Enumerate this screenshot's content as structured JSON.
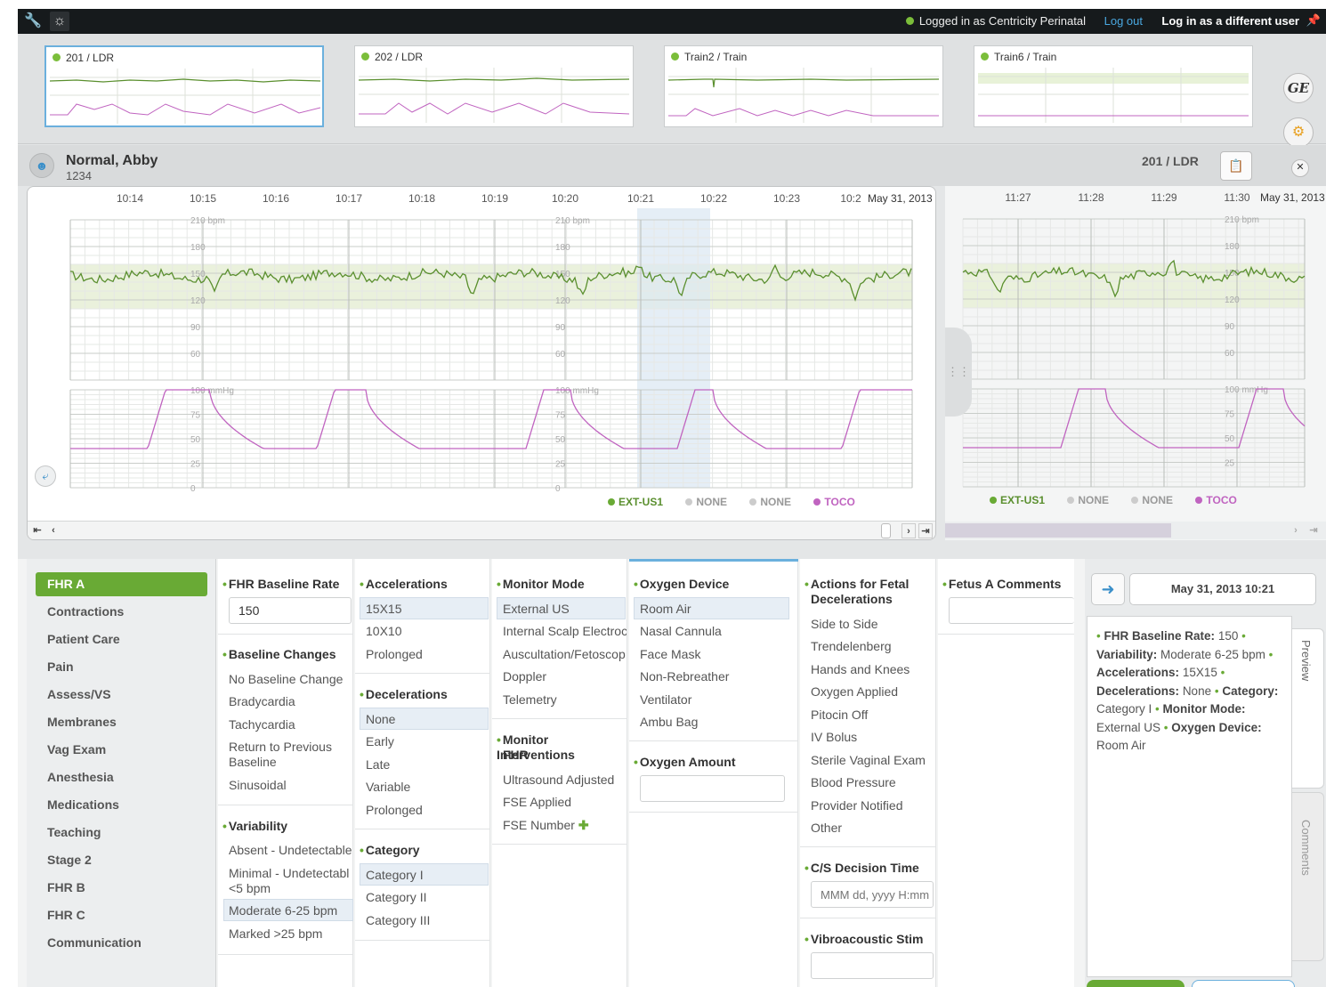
{
  "topbar": {
    "wrench_icon": "wrench-icon",
    "status": "Logged in as Centricity Perinatal",
    "logout": "Log out",
    "different_user": "Log in as a different user"
  },
  "monitors": [
    {
      "label": "201 / LDR"
    },
    {
      "label": "202 / LDR"
    },
    {
      "label": "Train2 / Train"
    },
    {
      "label": "Train6 / Train"
    }
  ],
  "patient": {
    "name": "Normal, Abby",
    "id": "1234",
    "bed": "201 / LDR"
  },
  "chart": {
    "times": [
      "10:14",
      "10:15",
      "10:16",
      "10:17",
      "10:18",
      "10:19",
      "10:20",
      "10:21",
      "10:22",
      "10:23",
      "10:2"
    ],
    "date": "May 31, 2013",
    "fhr_labels": [
      "210 bpm",
      "180",
      "150",
      "120",
      "90",
      "60"
    ],
    "uc_labels": [
      "100 mmHg",
      "75",
      "50",
      "25",
      "0"
    ],
    "legend": [
      "EXT-US1",
      "NONE",
      "NONE",
      "TOCO"
    ]
  },
  "chart_right": {
    "times": [
      "11:27",
      "11:28",
      "11:29",
      "11:30"
    ],
    "date": "May 31, 2013",
    "fhr_labels": [
      "210 bpm",
      "180",
      "150",
      "120",
      "90",
      "60"
    ],
    "uc_labels": [
      "100 mmHg",
      "75",
      "50",
      "25"
    ],
    "legend": [
      "EXT-US1",
      "NONE",
      "NONE",
      "TOCO"
    ]
  },
  "colors": {
    "accent": "#69aa35",
    "fhr": "#5a8f2e",
    "toco": "#c064c0",
    "select_blue": "#6bb0dd"
  },
  "nav": [
    "FHR A",
    "Contractions",
    "Patient Care",
    "Pain",
    "Assess/VS",
    "Membranes",
    "Vag Exam",
    "Anesthesia",
    "Medications",
    "Teaching",
    "Stage 2",
    "FHR B",
    "FHR C",
    "Communication"
  ],
  "form": {
    "fhr_baseline_rate": {
      "title": "FHR Baseline Rate",
      "value": "150"
    },
    "baseline_changes": {
      "title": "Baseline Changes",
      "options": [
        "No Baseline Change",
        "Bradycardia",
        "Tachycardia",
        "Return to Previous",
        "Baseline",
        "Sinusoidal"
      ]
    },
    "variability": {
      "title": "Variability",
      "options": [
        "Absent - Undetectable",
        "Minimal - Undetectabl",
        "<5 bpm",
        "Moderate 6-25 bpm",
        "Marked >25 bpm"
      ],
      "selected": "Moderate 6-25 bpm"
    },
    "accelerations": {
      "title": "Accelerations",
      "options": [
        "15X15",
        "10X10",
        "Prolonged"
      ],
      "selected": "15X15"
    },
    "decelerations": {
      "title": "Decelerations",
      "options": [
        "None",
        "Early",
        "Late",
        "Variable",
        "Prolonged"
      ],
      "selected": "None"
    },
    "category": {
      "title": "Category",
      "options": [
        "Category I",
        "Category II",
        "Category III"
      ],
      "selected": "Category I"
    },
    "monitor_mode": {
      "title": "Monitor Mode",
      "options": [
        "External US",
        "Internal Scalp Electroc",
        "Auscultation/Fetoscop",
        "Doppler",
        "Telemetry"
      ],
      "selected": "External US"
    },
    "monitor_interventions": {
      "title1": "Monitor Interventions",
      "title2": "FHR",
      "options": [
        "Ultrasound Adjusted",
        "FSE Applied",
        "FSE Number"
      ]
    },
    "oxygen_device": {
      "title": "Oxygen Device",
      "options": [
        "Room Air",
        "Nasal Cannula",
        "Face Mask",
        "Non-Rebreather",
        "Ventilator",
        "Ambu Bag"
      ],
      "selected": "Room Air"
    },
    "oxygen_amount": {
      "title": "Oxygen Amount",
      "value": ""
    },
    "actions": {
      "title1": "Actions for Fetal",
      "title2": "Decelerations",
      "options": [
        "Side to Side",
        "Trendelenberg",
        "Hands and Knees",
        "Oxygen Applied",
        "Pitocin Off",
        "IV Bolus",
        "Sterile Vaginal Exam",
        "Blood Pressure",
        "Provider Notified",
        "Other"
      ]
    },
    "cs_decision": {
      "title": "C/S Decision Time",
      "placeholder": "MMM dd, yyyy H:mm"
    },
    "vibroacoustic": {
      "title": "Vibroacoustic Stim",
      "value": ""
    },
    "fetus_comments": {
      "title": "Fetus A Comments",
      "value": ""
    }
  },
  "preview": {
    "datetime": "May 31, 2013 10:21",
    "lines": [
      {
        "k": "FHR Baseline Rate:",
        "v": "150"
      },
      {
        "k": "Variability:",
        "v": "Moderate 6-25 bpm"
      },
      {
        "k": "Accelerations:",
        "v": "15X15"
      },
      {
        "k": "Decelerations:",
        "v": "None"
      },
      {
        "k": "Category:",
        "v": "Category I"
      },
      {
        "k": "Monitor Mode:",
        "v": "External US"
      },
      {
        "k": "Oxygen Device:",
        "v": "Room Air"
      }
    ],
    "tab_preview": "Preview",
    "tab_comments": "Comments"
  }
}
